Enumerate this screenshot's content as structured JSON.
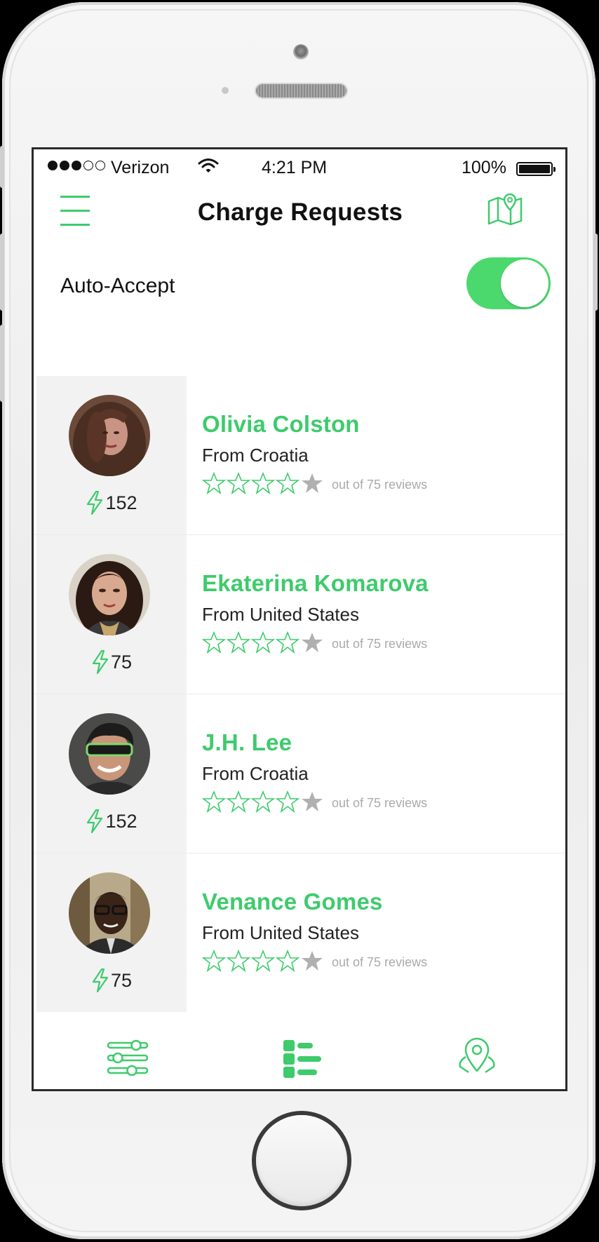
{
  "status": {
    "signal": "●●●○○",
    "carrier": "Verizon",
    "time": "4:21 PM",
    "battery": "100%"
  },
  "header": {
    "title": "Charge Requests"
  },
  "auto_accept": {
    "label": "Auto-Accept",
    "on": true
  },
  "requests": [
    {
      "name": "Olivia Colston",
      "from": "From Croatia",
      "charge": "152",
      "stars_filled": 4,
      "stars_total": 5,
      "reviews": "out of 75 reviews"
    },
    {
      "name": "Ekaterina Komarova",
      "from": "From United States",
      "charge": "75",
      "stars_filled": 4,
      "stars_total": 5,
      "reviews": "out of 75 reviews"
    },
    {
      "name": "J.H. Lee",
      "from": "From Croatia",
      "charge": "152",
      "stars_filled": 4,
      "stars_total": 5,
      "reviews": "out of 75 reviews"
    },
    {
      "name": "Venance Gomes",
      "from": "From United States",
      "charge": "75",
      "stars_filled": 4,
      "stars_total": 5,
      "reviews": "out of 75 reviews"
    }
  ],
  "tabs": [
    {
      "icon": "sliders-icon",
      "active": false
    },
    {
      "icon": "list-icon",
      "active": true
    },
    {
      "icon": "location-pin-icon",
      "active": false
    }
  ],
  "colors": {
    "accent": "#3ecb6c",
    "toggle": "#4bd96e",
    "star_empty": "#b0b0b0"
  }
}
